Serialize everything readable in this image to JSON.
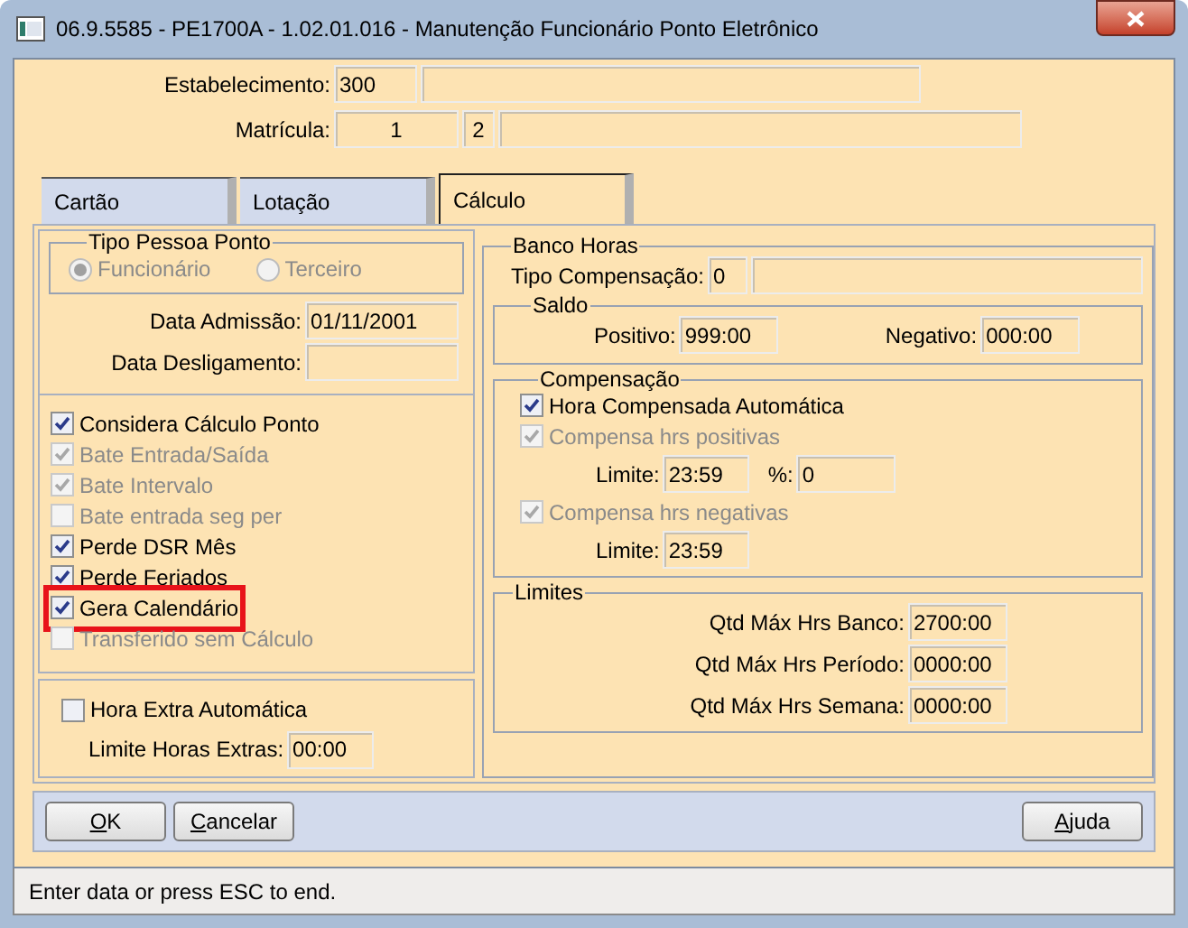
{
  "window": {
    "title": "06.9.5585 - PE1700A - 1.02.01.016 - Manutenção Funcionário Ponto Eletrônico"
  },
  "header": {
    "estabelecimento": {
      "label": "Estabelecimento:",
      "value": "300"
    },
    "matricula": {
      "label": "Matrícula:",
      "value": "1",
      "digit": "2"
    }
  },
  "tabs": [
    {
      "label": "Cartão",
      "selected": false
    },
    {
      "label": "Lotação",
      "selected": false
    },
    {
      "label": "Cálculo",
      "selected": true
    }
  ],
  "tipo_pessoa": {
    "legend": "Tipo Pessoa Ponto",
    "options": [
      {
        "label": "Funcionário",
        "selected": true,
        "disabled": true
      },
      {
        "label": "Terceiro",
        "selected": false,
        "disabled": true
      }
    ]
  },
  "dates": [
    {
      "label": "Data Admissão:",
      "value": "01/11/2001"
    },
    {
      "label": "Data Desligamento:"
    }
  ],
  "checks": [
    {
      "label": "Considera Cálculo Ponto",
      "checked": true,
      "disabled": false,
      "highlighted": false
    },
    {
      "label": "Bate Entrada/Saída",
      "checked": true,
      "disabled": true,
      "highlighted": false
    },
    {
      "label": "Bate Intervalo",
      "checked": true,
      "disabled": true,
      "highlighted": false
    },
    {
      "label": "Bate entrada seg per",
      "checked": false,
      "disabled": true,
      "highlighted": false
    },
    {
      "label": "Perde DSR Mês",
      "checked": true,
      "disabled": false,
      "highlighted": false
    },
    {
      "label": "Perde Feriados",
      "checked": true,
      "disabled": false,
      "highlighted": false
    },
    {
      "label": "Gera Calendário",
      "checked": true,
      "disabled": false,
      "highlighted": true
    },
    {
      "label": "Transferido sem Cálculo",
      "checked": false,
      "disabled": true,
      "highlighted": false
    }
  ],
  "hora_extra": {
    "check": {
      "label": "Hora Extra Automática",
      "checked": false,
      "disabled": false
    },
    "limit_label": "Limite Horas Extras:",
    "limit_value": "00:00"
  },
  "banco_horas": {
    "legend": "Banco Horas",
    "tipo_label": "Tipo Compensação:",
    "tipo_value": "0",
    "saldo": {
      "legend": "Saldo",
      "positivo_label": "Positivo:",
      "positivo_value": "999:00",
      "negativo_label": "Negativo:",
      "negativo_value": "000:00"
    },
    "compensacao": {
      "legend": "Compensação",
      "auto": {
        "label": "Hora Compensada Automática",
        "checked": true,
        "disabled": false
      },
      "positivas": {
        "label": "Compensa hrs positivas",
        "checked": true,
        "disabled": true
      },
      "limite_pos_label": "Limite:",
      "limite_pos_value": "23:59",
      "pct_label": "%:",
      "pct_value": "0",
      "negativas": {
        "label": "Compensa hrs negativas",
        "checked": true,
        "disabled": true
      },
      "limite_neg_label": "Limite:",
      "limite_neg_value": "23:59"
    },
    "limites": {
      "legend": "Limites",
      "rows": [
        {
          "label": "Qtd Máx Hrs Banco:",
          "value": "2700:00"
        },
        {
          "label": "Qtd Máx Hrs Período:",
          "value": "0000:00"
        },
        {
          "label": "Qtd Máx Hrs Semana:",
          "value": "0000:00"
        }
      ]
    }
  },
  "buttons": {
    "left": [
      "OK",
      "Cancelar"
    ],
    "right": [
      "Ajuda"
    ]
  },
  "status_bar": "Enter data or press ESC to end."
}
